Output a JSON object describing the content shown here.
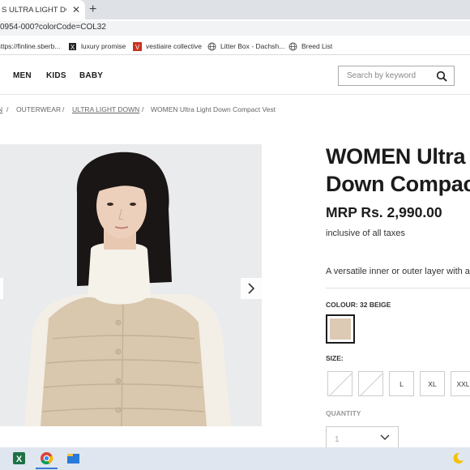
{
  "browser": {
    "tab_title": "S ULTRA LIGHT DOWN",
    "url": "0954-000?colorCode=COL32",
    "bookmarks": [
      {
        "label": "https://finline.sberb...",
        "icon": "globe-icon"
      },
      {
        "label": "luxury promise",
        "icon": "bookmark-logo-icon"
      },
      {
        "label": "vestiaire collective",
        "icon": "vestiaire-logo-icon"
      },
      {
        "label": "Litter Box - Dachsh...",
        "icon": "globe-icon"
      },
      {
        "label": "Breed List",
        "icon": "globe-icon"
      }
    ]
  },
  "nav": {
    "items": [
      "MEN",
      "KIDS",
      "BABY"
    ],
    "search_placeholder": "Search by keyword"
  },
  "breadcrumb": [
    {
      "label": "N",
      "link": true
    },
    {
      "label": "OUTERWEAR",
      "link": false
    },
    {
      "label": "ULTRA LIGHT DOWN",
      "link": true
    },
    {
      "label": "WOMEN Ultra Light Down Compact Vest",
      "link": false
    }
  ],
  "product": {
    "title_line1": "WOMEN Ultra",
    "title_line2": "Down Compact",
    "price": "MRP Rs. 2,990.00",
    "tax_note": "inclusive of all taxes",
    "description": "A versatile inner or outer layer with a",
    "colour_label": "COLOUR: 32 BEIGE",
    "colour_hex": "#dccab4",
    "size_label": "SIZE:",
    "sizes": [
      {
        "label": "",
        "available": false
      },
      {
        "label": "",
        "available": false
      },
      {
        "label": "L",
        "available": true
      },
      {
        "label": "XL",
        "available": true
      },
      {
        "label": "XXL",
        "available": true
      }
    ],
    "quantity_label": "QUANTITY",
    "quantity_value": "1"
  },
  "colors": {
    "accent": "#1b1b1b",
    "vest": "#d8c6ae"
  }
}
